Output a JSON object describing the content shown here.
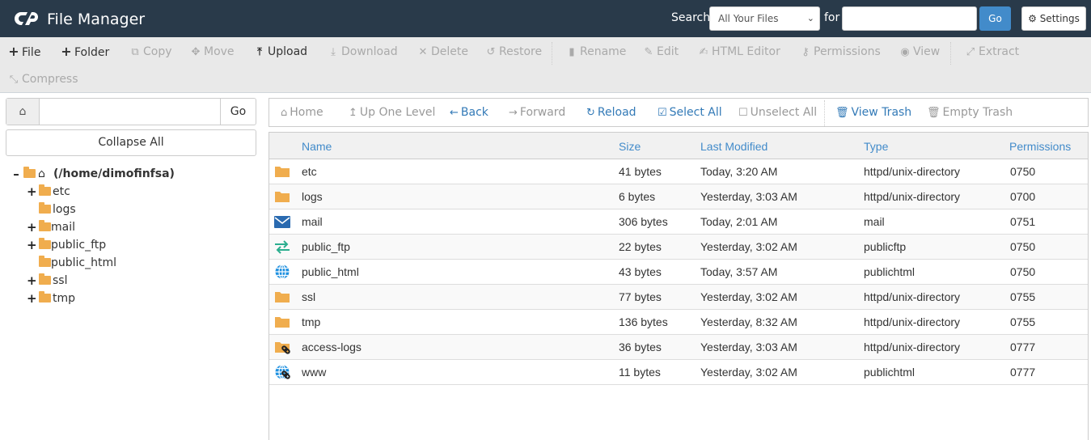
{
  "header": {
    "app_title": "File Manager",
    "search_label": "Search",
    "search_scope": "All Your Files",
    "for_label": "for",
    "search_value": "",
    "go_label": "Go",
    "settings_label": "Settings"
  },
  "toolbar": {
    "items": [
      {
        "label": "File",
        "icon": "plus-icon",
        "enabled": true
      },
      {
        "label": "Folder",
        "icon": "plus-icon",
        "enabled": true
      },
      {
        "label": "Copy",
        "icon": "copy-icon",
        "enabled": false
      },
      {
        "label": "Move",
        "icon": "move-icon",
        "enabled": false
      },
      {
        "label": "Upload",
        "icon": "upload-icon",
        "enabled": true
      },
      {
        "label": "Download",
        "icon": "download-icon",
        "enabled": false
      },
      {
        "label": "Delete",
        "icon": "delete-icon",
        "enabled": false
      },
      {
        "label": "Restore",
        "icon": "restore-icon",
        "enabled": false
      },
      {
        "label": "Rename",
        "icon": "file-icon",
        "enabled": false
      },
      {
        "label": "Edit",
        "icon": "pencil-icon",
        "enabled": false
      },
      {
        "label": "HTML Editor",
        "icon": "edit-square-icon",
        "enabled": false
      },
      {
        "label": "Permissions",
        "icon": "key-icon",
        "enabled": false
      },
      {
        "label": "View",
        "icon": "eye-icon",
        "enabled": false
      },
      {
        "label": "Extract",
        "icon": "expand-icon",
        "enabled": false
      },
      {
        "label": "Compress",
        "icon": "compress-icon",
        "enabled": false
      }
    ]
  },
  "sidebar": {
    "path_value": "",
    "go_label": "Go",
    "collapse_label": "Collapse All",
    "tree": {
      "root_label": "(/home/dimofinfsa)",
      "children": [
        {
          "label": "etc",
          "expandable": true
        },
        {
          "label": "logs",
          "expandable": false
        },
        {
          "label": "mail",
          "expandable": true
        },
        {
          "label": "public_ftp",
          "expandable": true
        },
        {
          "label": "public_html",
          "expandable": false
        },
        {
          "label": "ssl",
          "expandable": true
        },
        {
          "label": "tmp",
          "expandable": true
        }
      ]
    }
  },
  "main_toolbar": {
    "items": [
      {
        "label": "Home",
        "icon": "home-icon",
        "active": false
      },
      {
        "label": "Up One Level",
        "icon": "level-up-icon",
        "active": false
      },
      {
        "label": "Back",
        "icon": "arrow-left-icon",
        "active": true
      },
      {
        "label": "Forward",
        "icon": "arrow-right-icon",
        "active": false
      },
      {
        "label": "Reload",
        "icon": "reload-icon",
        "active": true
      },
      {
        "label": "Select All",
        "icon": "checkbox-checked-icon",
        "active": true
      },
      {
        "label": "Unselect All",
        "icon": "checkbox-empty-icon",
        "active": false
      },
      {
        "label": "View Trash",
        "icon": "trash-icon",
        "active": true
      },
      {
        "label": "Empty Trash",
        "icon": "trash-icon",
        "active": false
      }
    ]
  },
  "table": {
    "columns": [
      "Name",
      "Size",
      "Last Modified",
      "Type",
      "Permissions"
    ],
    "rows": [
      {
        "icon": "folder-icon",
        "name": "etc",
        "size": "41 bytes",
        "modified": "Today, 3:20 AM",
        "type": "httpd/unix-directory",
        "perms": "0750"
      },
      {
        "icon": "folder-icon",
        "name": "logs",
        "size": "6 bytes",
        "modified": "Yesterday, 3:03 AM",
        "type": "httpd/unix-directory",
        "perms": "0700"
      },
      {
        "icon": "mail-icon",
        "name": "mail",
        "size": "306 bytes",
        "modified": "Today, 2:01 AM",
        "type": "mail",
        "perms": "0751"
      },
      {
        "icon": "ftp-icon",
        "name": "public_ftp",
        "size": "22 bytes",
        "modified": "Yesterday, 3:02 AM",
        "type": "publicftp",
        "perms": "0750"
      },
      {
        "icon": "globe-icon",
        "name": "public_html",
        "size": "43 bytes",
        "modified": "Today, 3:57 AM",
        "type": "publichtml",
        "perms": "0750"
      },
      {
        "icon": "folder-icon",
        "name": "ssl",
        "size": "77 bytes",
        "modified": "Yesterday, 3:02 AM",
        "type": "httpd/unix-directory",
        "perms": "0755"
      },
      {
        "icon": "folder-icon",
        "name": "tmp",
        "size": "136 bytes",
        "modified": "Yesterday, 8:32 AM",
        "type": "httpd/unix-directory",
        "perms": "0755"
      },
      {
        "icon": "folder-link-icon",
        "name": "access-logs",
        "size": "36 bytes",
        "modified": "Yesterday, 3:03 AM",
        "type": "httpd/unix-directory",
        "perms": "0777"
      },
      {
        "icon": "globe-link-icon",
        "name": "www",
        "size": "11 bytes",
        "modified": "Yesterday, 3:02 AM",
        "type": "publichtml",
        "perms": "0777"
      }
    ]
  },
  "colors": {
    "header_bg": "#293a4a",
    "accent": "#428bca",
    "folder": "#f0ad4e",
    "mail": "#2a6ab0",
    "ftp": "#2bae8f",
    "globe": "#1e90e0"
  }
}
